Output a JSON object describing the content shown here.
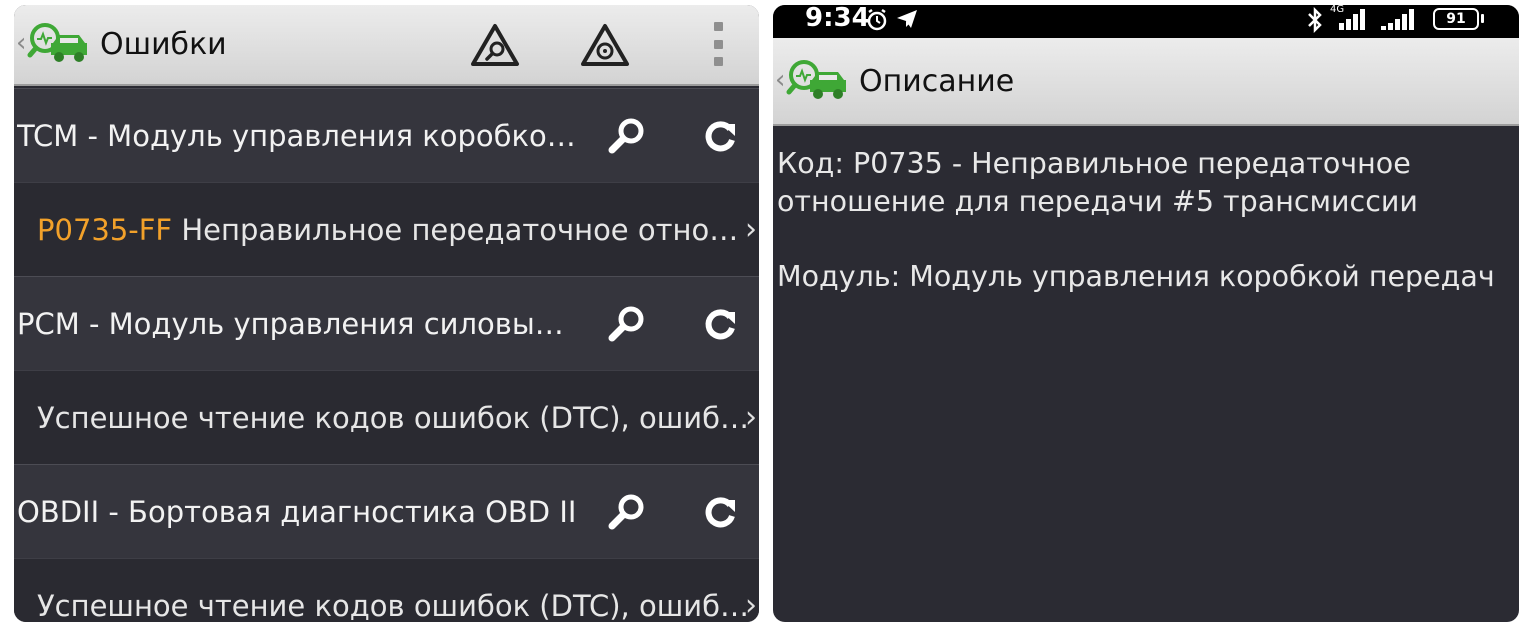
{
  "left": {
    "actionbar": {
      "title": "Ошибки",
      "icons": [
        "back-chevron-icon",
        "car-diagnostic-logo-icon",
        "warning-magnify-icon",
        "warning-gauge-icon",
        "overflow-menu-icon"
      ]
    },
    "rows": [
      {
        "kind": "header",
        "text": "TCM - Модуль управления коробко…"
      },
      {
        "kind": "item",
        "code": "P0735-FF",
        "text": " Неправильное передаточное отно…"
      },
      {
        "kind": "header",
        "text": "PCM - Модуль управления силовы…"
      },
      {
        "kind": "item",
        "code": "",
        "text": "Успешное чтение кодов ошибок (DTC), ошиб…"
      },
      {
        "kind": "header",
        "text": "OBDII - Бортовая диагностика OBD II"
      },
      {
        "kind": "item",
        "code": "",
        "text": "Успешное чтение кодов ошибок (DTC), ошиб…"
      }
    ]
  },
  "right": {
    "statusbar": {
      "time": "9:34",
      "network": "4G",
      "battery": "91"
    },
    "actionbar": {
      "title": "Описание"
    },
    "description": {
      "line1": "Код: P0735 - Неправильное передаточное",
      "line2": "отношение для передачи #5 трансмиссии",
      "line3": "Модуль: Модуль управления коробкой передач"
    }
  },
  "colors": {
    "accent_code": "#f2a12a",
    "logo_green": "#3fa836",
    "panel_bg": "#2b2b33"
  }
}
